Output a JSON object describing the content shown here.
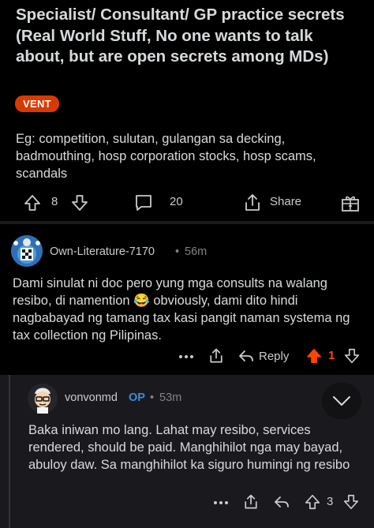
{
  "post": {
    "title": "Specialist/ Consultant/ GP practice secrets (Real World Stuff, No one wants to talk about, but are open secrets among MDs)",
    "flair": "VENT",
    "body": "Eg: competition, sulutan, gulangan sa decking, badmouthing, hosp corporation stocks, hosp scams, scandals",
    "score": "8",
    "comments": "20",
    "share_label": "Share",
    "colors": {
      "flair_bg": "#d93a00"
    },
    "icons": [
      "upvote-icon",
      "downvote-icon",
      "comment-bubble-icon",
      "share-icon",
      "award-icon"
    ]
  },
  "comments": [
    {
      "username": "Own-Literature-7170",
      "time": "56m",
      "body": "Dami sinulat ni doc pero yung mga consults na walang resibo, di namention",
      "emoji": "😂",
      "body_after": " obviously, dami dito hindi nagbabayad ng tamang tax kasi pangit naman systema ng tax collection ng Pilipinas.",
      "reply_label": "Reply",
      "score": "1",
      "upvoted": true,
      "colors": {
        "upvote_active": "#ff4500"
      }
    },
    {
      "username": "vonvonmd",
      "op_tag": "OP",
      "time": "53m",
      "body": "Baka iniwan mo lang. Lahat may resibo, services rendered, should be paid. Manghihilot nga may bayad, abuloy daw. Sa manghihilot ka siguro humingi ng resibo",
      "score": "3"
    }
  ],
  "separator": "•"
}
